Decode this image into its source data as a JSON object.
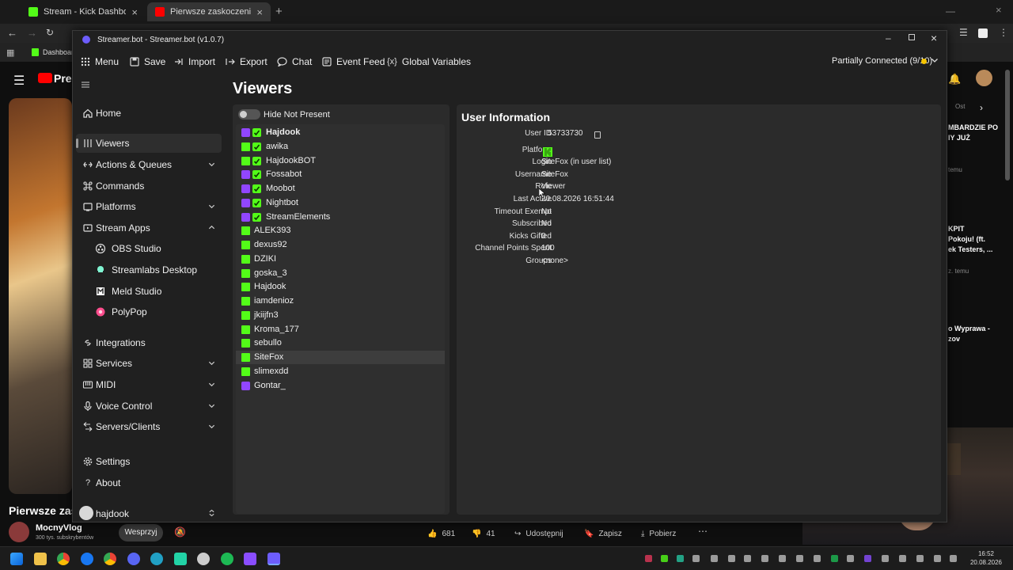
{
  "browser": {
    "tabs": [
      {
        "label": "Stream - Kick Dashboard",
        "color": "#53fc18"
      },
      {
        "label": "Pierwsze zaskoczenie - Hradec",
        "color": "#ff0000"
      }
    ],
    "bookmark": "Dashboard"
  },
  "youtube": {
    "logo_text": "Prem",
    "video_title": "Pierwsze zask",
    "channel_name": "MocnyVlog",
    "subscribers": "300 tys. subskrybentów",
    "support_button": "Wesprzyj",
    "likes": "681",
    "dislikes": "41",
    "share": "Udostępnij",
    "save": "Zapisz",
    "download": "Pobierz",
    "sidebar_texts": [
      "Ost",
      "MBARDZIE PO",
      "IY JUŻ",
      "temu",
      "KPIT",
      "Pokoju! (ft.",
      "ek Testers, ...",
      "z. temu",
      "o Wyprawa -",
      "zov"
    ]
  },
  "app": {
    "title": "Streamer.bot - Streamer.bot (v1.0.7)",
    "menu": [
      "Menu",
      "Save",
      "Import",
      "Export",
      "Chat",
      "Event Feed",
      "Global Variables"
    ],
    "connection_status": "Partially Connected (9/10)",
    "status_color": "#f5c400",
    "sidebar": {
      "items": [
        {
          "label": "Home",
          "icon": "home-icon"
        },
        {
          "label": "Viewers",
          "icon": "viewers-icon"
        },
        {
          "label": "Actions & Queues",
          "icon": "actions-icon"
        },
        {
          "label": "Commands",
          "icon": "command-icon"
        },
        {
          "label": "Platforms",
          "icon": "platforms-icon"
        },
        {
          "label": "Stream Apps",
          "icon": "stream-apps-icon"
        },
        {
          "label": "OBS Studio",
          "icon": "obs-icon"
        },
        {
          "label": "Streamlabs Desktop",
          "icon": "streamlabs-icon"
        },
        {
          "label": "Meld Studio",
          "icon": "meld-icon"
        },
        {
          "label": "PolyPop",
          "icon": "polypop-icon"
        },
        {
          "label": "Integrations",
          "icon": "integrations-icon"
        },
        {
          "label": "Services",
          "icon": "services-icon"
        },
        {
          "label": "MIDI",
          "icon": "midi-icon"
        },
        {
          "label": "Voice Control",
          "icon": "microphone-icon"
        },
        {
          "label": "Servers/Clients",
          "icon": "servers-icon"
        },
        {
          "label": "Settings",
          "icon": "gear-icon"
        },
        {
          "label": "About",
          "icon": "question-icon"
        }
      ],
      "user": "hajdook"
    },
    "viewers": {
      "title": "Viewers",
      "toggle_label": "Hide Not Present",
      "list": [
        {
          "name": "Hajdook",
          "platform": "twitch",
          "bot": true,
          "bold": true
        },
        {
          "name": "awika",
          "platform": "kick",
          "bot": true
        },
        {
          "name": "HajdookBOT",
          "platform": "kick",
          "bot": true
        },
        {
          "name": "Fossabot",
          "platform": "twitch",
          "bot": true
        },
        {
          "name": "Moobot",
          "platform": "twitch",
          "bot": true
        },
        {
          "name": "Nightbot",
          "platform": "twitch",
          "bot": true
        },
        {
          "name": "StreamElements",
          "platform": "twitch",
          "bot": true
        },
        {
          "name": "ALEK393",
          "platform": "kick"
        },
        {
          "name": "dexus92",
          "platform": "kick"
        },
        {
          "name": "DZIKI",
          "platform": "kick"
        },
        {
          "name": "goska_3",
          "platform": "kick"
        },
        {
          "name": "Hajdook",
          "platform": "kick"
        },
        {
          "name": "iamdenioz",
          "platform": "kick"
        },
        {
          "name": "jkiijfn3",
          "platform": "kick"
        },
        {
          "name": "Kroma_177",
          "platform": "kick"
        },
        {
          "name": "sebullo",
          "platform": "kick"
        },
        {
          "name": "SiteFox",
          "platform": "kick",
          "selected": true
        },
        {
          "name": "slimexdd",
          "platform": "kick"
        },
        {
          "name": "Gontar_",
          "platform": "twitch"
        }
      ]
    },
    "user_info": {
      "title": "User Information",
      "fields": [
        {
          "label": "User ID",
          "value": "53733730"
        },
        {
          "label": "Platform",
          "value": ""
        },
        {
          "label": "Login",
          "value": "SiteFox (in user list)"
        },
        {
          "label": "Username",
          "value": "SiteFox"
        },
        {
          "label": "Role",
          "value": "Viewer"
        },
        {
          "label": "Last Active",
          "value": "20.08.2026 16:51:44"
        },
        {
          "label": "Timeout Exempt",
          "value": "No"
        },
        {
          "label": "Subscribed",
          "value": "No"
        },
        {
          "label": "Kicks Gifted",
          "value": "0"
        },
        {
          "label": "Channel Points Spent",
          "value": "100"
        },
        {
          "label": "Groups",
          "value": "<none>"
        }
      ]
    }
  },
  "taskbar": {
    "time": "16:52",
    "date": "20.08.2026"
  }
}
